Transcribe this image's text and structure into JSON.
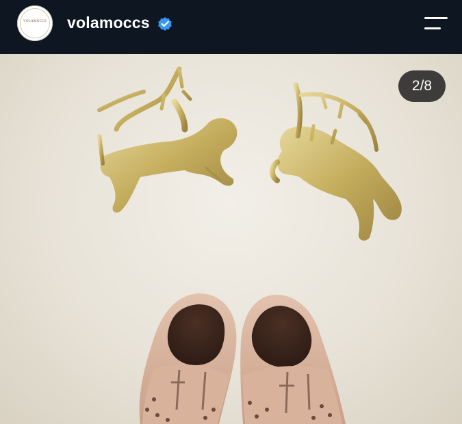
{
  "header": {
    "avatar_logo_text": "VOLAMOCCS",
    "username": "volamoccs",
    "verified_icon": "verified-badge-icon",
    "menu_icon": "hamburger-menu-icon"
  },
  "post": {
    "image_description": "photo of two gold glitter reindeer figurines above a pair of metallic rose-gold baby moccasins",
    "carousel_counter": "2/8"
  },
  "colors": {
    "header_bg": "#0e1622",
    "verified_blue": "#3897f0",
    "counter_bg": "#262626"
  }
}
